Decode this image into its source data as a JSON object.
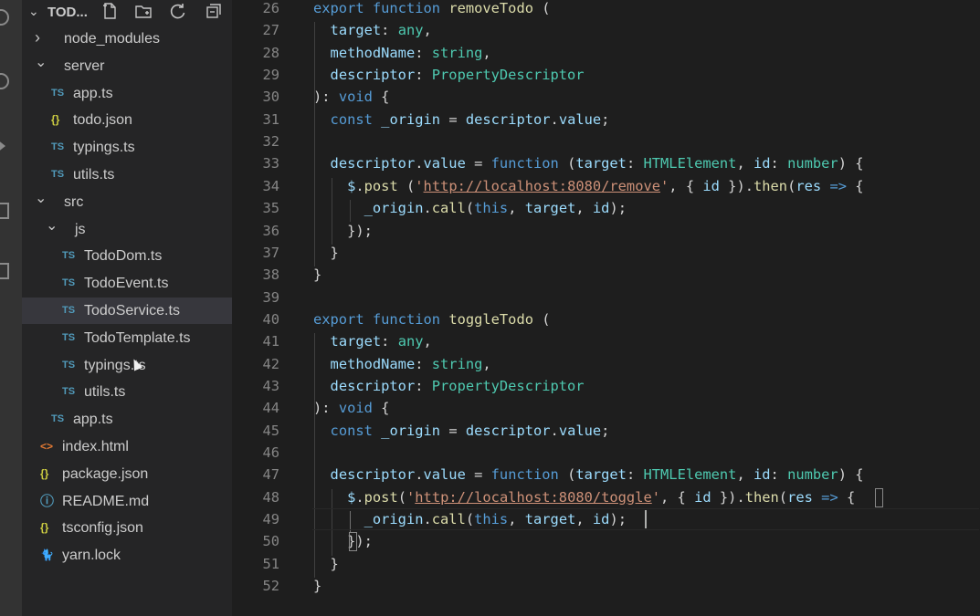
{
  "explorer": {
    "title": "TOD...",
    "tree": [
      {
        "label": "node_modules",
        "type": "folder",
        "expanded": false,
        "icon": "chevron-right-icon"
      },
      {
        "label": "server",
        "type": "folder",
        "expanded": true,
        "icon": "chevron-down-icon"
      },
      {
        "label": "app.ts",
        "type": "file",
        "badge": "TS"
      },
      {
        "label": "todo.json",
        "type": "file",
        "badge": "{}"
      },
      {
        "label": "typings.ts",
        "type": "file",
        "badge": "TS"
      },
      {
        "label": "utils.ts",
        "type": "file",
        "badge": "TS"
      },
      {
        "label": "src",
        "type": "folder",
        "expanded": true,
        "icon": "chevron-down-icon"
      },
      {
        "label": "js",
        "type": "folder",
        "expanded": true,
        "icon": "chevron-down-icon"
      },
      {
        "label": "TodoDom.ts",
        "type": "file",
        "badge": "TS"
      },
      {
        "label": "TodoEvent.ts",
        "type": "file",
        "badge": "TS"
      },
      {
        "label": "TodoService.ts",
        "type": "file",
        "badge": "TS",
        "selected": true
      },
      {
        "label": "TodoTemplate.ts",
        "type": "file",
        "badge": "TS"
      },
      {
        "label": "typings.ts",
        "type": "file",
        "badge": "TS"
      },
      {
        "label": "utils.ts",
        "type": "file",
        "badge": "TS"
      },
      {
        "label": "app.ts",
        "type": "file",
        "badge": "TS"
      },
      {
        "label": "index.html",
        "type": "file",
        "badge": "<>"
      },
      {
        "label": "package.json",
        "type": "file",
        "badge": "{}"
      },
      {
        "label": "README.md",
        "type": "file",
        "badge": "ⓘ"
      },
      {
        "label": "tsconfig.json",
        "type": "file",
        "badge": "{}"
      },
      {
        "label": "yarn.lock",
        "type": "file",
        "badge": "yarn"
      }
    ]
  },
  "editor": {
    "lines": [
      {
        "n": "26",
        "t": "export function removeTodo ("
      },
      {
        "n": "27",
        "t": "  target: any,"
      },
      {
        "n": "28",
        "t": "  methodName: string,"
      },
      {
        "n": "29",
        "t": "  descriptor: PropertyDescriptor"
      },
      {
        "n": "30",
        "t": "): void {"
      },
      {
        "n": "31",
        "t": "  const _origin = descriptor.value;"
      },
      {
        "n": "32",
        "t": ""
      },
      {
        "n": "33",
        "t": "  descriptor.value = function (target: HTMLElement, id: number) {"
      },
      {
        "n": "34",
        "t": "    $.post ('http://localhost:8080/remove', { id }).then(res => {"
      },
      {
        "n": "35",
        "t": "      _origin.call(this, target, id);"
      },
      {
        "n": "36",
        "t": "    });"
      },
      {
        "n": "37",
        "t": "  }"
      },
      {
        "n": "38",
        "t": "}"
      },
      {
        "n": "39",
        "t": ""
      },
      {
        "n": "40",
        "t": "export function toggleTodo ("
      },
      {
        "n": "41",
        "t": "  target: any,"
      },
      {
        "n": "42",
        "t": "  methodName: string,"
      },
      {
        "n": "43",
        "t": "  descriptor: PropertyDescriptor"
      },
      {
        "n": "44",
        "t": "): void {"
      },
      {
        "n": "45",
        "t": "  const _origin = descriptor.value;"
      },
      {
        "n": "46",
        "t": ""
      },
      {
        "n": "47",
        "t": "  descriptor.value = function (target: HTMLElement, id: number) {"
      },
      {
        "n": "48",
        "t": "    $.post('http://localhost:8080/toggle', { id }).then(res => {"
      },
      {
        "n": "49",
        "t": "      _origin.call(this, target, id);"
      },
      {
        "n": "50",
        "t": "    });"
      },
      {
        "n": "51",
        "t": "  }"
      },
      {
        "n": "52",
        "t": "}"
      }
    ]
  },
  "colors": {
    "keyword": "#569cd6",
    "function": "#dcdcaa",
    "variable": "#9cdcfe",
    "type": "#4ec9b0",
    "string": "#ce9178"
  }
}
